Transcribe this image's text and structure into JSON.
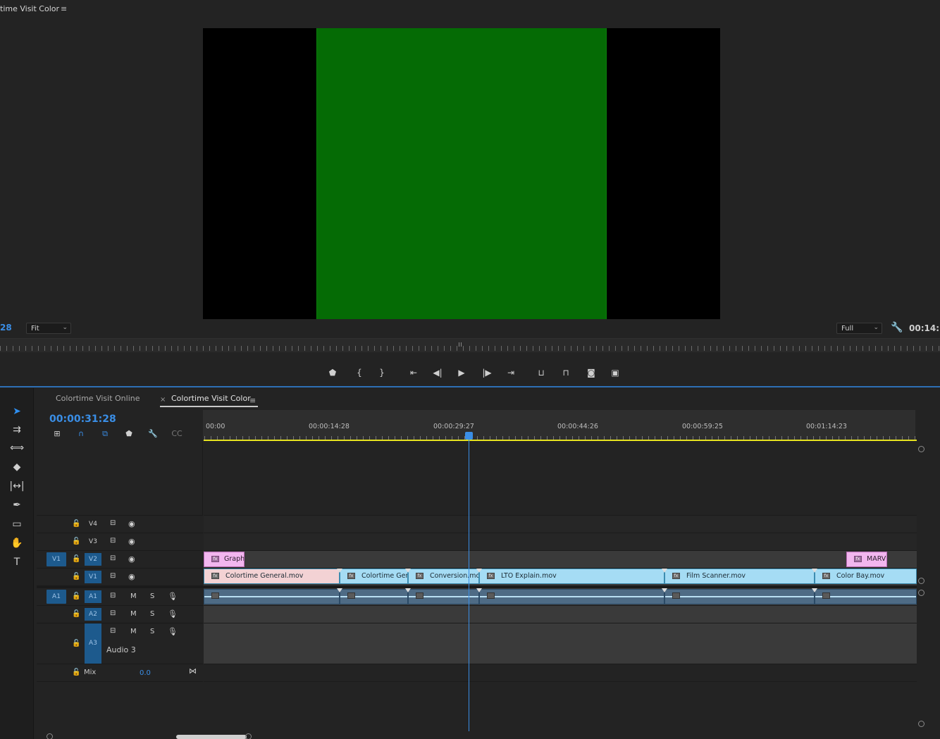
{
  "program_monitor": {
    "title": "time Visit Color",
    "menu_icon": "hamburger-icon",
    "timecode_left": "28",
    "zoom_select": "Fit",
    "quality_select": "Full",
    "timecode_right": "00:14:",
    "video_colors": {
      "letterbox": "#000000",
      "frame": "#056b05"
    },
    "transport": [
      "marker-icon",
      "mark-in-icon",
      "mark-out-icon",
      "go-to-in-icon",
      "step-back-icon",
      "play-icon",
      "step-forward-icon",
      "go-to-out-icon",
      "lift-icon",
      "extract-icon",
      "export-frame-icon",
      "button-editor-icon"
    ]
  },
  "tools": [
    "selection-tool-icon",
    "track-select-tool-icon",
    "ripple-edit-tool-icon",
    "razor-tool-icon",
    "slip-tool-icon",
    "pen-tool-icon",
    "rectangle-tool-icon",
    "hand-tool-icon",
    "type-tool-icon"
  ],
  "timeline": {
    "tabs": [
      {
        "label": "Colortime Visit Online",
        "active": false
      },
      {
        "label": "Colortime Visit Color",
        "active": true
      }
    ],
    "close_glyph": "×",
    "timecode": "00:00:31:28",
    "ruler_labels": [
      "00:00",
      "00:00:14:28",
      "00:00:29:27",
      "00:00:44:26",
      "00:00:59:25",
      "00:01:14:23"
    ],
    "tracks": {
      "v4": "V4",
      "v3": "V3",
      "v2": "V2",
      "v1": "V1",
      "src_v1": "V1",
      "src_a1": "A1",
      "a1": "A1",
      "a2": "A2",
      "a3": "A3",
      "a3_name": "Audio 3",
      "mute": "M",
      "solo": "S",
      "mix_label": "Mix",
      "mix_value": "0.0"
    },
    "clips_v2": [
      "Graphi",
      "MARVI"
    ],
    "clips_v1": [
      "Colortime General.mov",
      "Colortime Gene",
      "Conversion.mov",
      "LTO Explain.mov",
      "Film Scanner.mov",
      "Color Bay.mov"
    ],
    "fx_badge": "fx",
    "colors": {
      "accent": "#3a8ee6",
      "video_clip": "#a5dcf4",
      "graphic_clip": "#f2b6ef",
      "in_out_bar": "#e6e220"
    }
  }
}
